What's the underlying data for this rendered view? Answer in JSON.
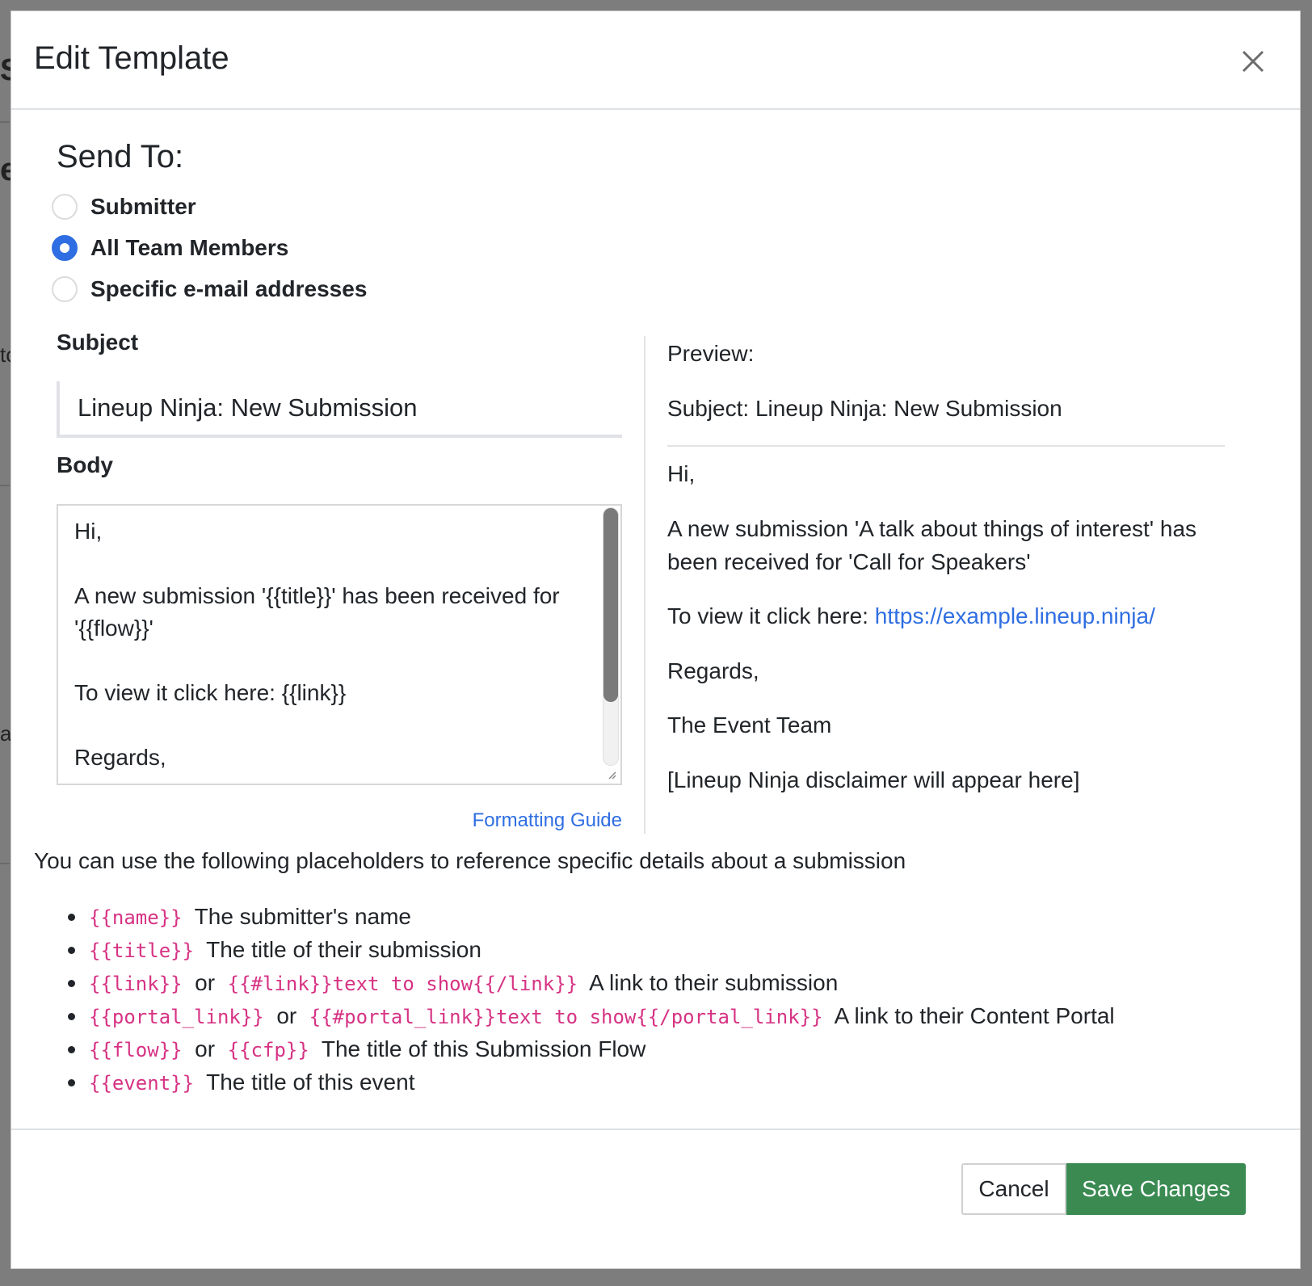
{
  "backdrop": {
    "fragments": [
      "S",
      "e",
      "to",
      "a"
    ]
  },
  "modal": {
    "title": "Edit Template",
    "close_icon": "close-icon"
  },
  "send_to": {
    "title": "Send To:",
    "options": [
      {
        "label": "Submitter",
        "checked": false
      },
      {
        "label": "All Team Members",
        "checked": true
      },
      {
        "label": "Specific e-mail addresses",
        "checked": false
      }
    ]
  },
  "subject": {
    "label": "Subject",
    "value": "Lineup Ninja: New Submission"
  },
  "body": {
    "label": "Body",
    "lines": [
      "Hi,",
      "",
      "A new submission '{{title}}' has been received for '{{flow}}'",
      "",
      "To view it click here: {{link}}",
      "",
      "Regards,"
    ],
    "formatting_link": "Formatting Guide"
  },
  "preview": {
    "label": "Preview:",
    "subject": "Subject: Lineup Ninja: New Submission",
    "greeting": "Hi,",
    "message": "A new submission 'A talk about things of interest' has been received for 'Call for Speakers'",
    "link_prefix": "To view it click here: ",
    "link_text": "https://example.lineup.ninja/",
    "regards": "Regards,",
    "signature": "The Event Team",
    "disclaimer": "[Lineup Ninja disclaimer will appear here]"
  },
  "placeholders": {
    "intro": "You can use the following placeholders to reference specific details about a submission",
    "items": [
      {
        "code1": "{{name}}",
        "or": "",
        "code2": "",
        "desc": "The submitter's name"
      },
      {
        "code1": "{{title}}",
        "or": "",
        "code2": "",
        "desc": "The title of their submission"
      },
      {
        "code1": "{{link}}",
        "or": "or",
        "code2": "{{#link}}text to show{{/link}}",
        "desc": "A link to their submission"
      },
      {
        "code1": "{{portal_link}}",
        "or": "or",
        "code2": "{{#portal_link}}text to show{{/portal_link}}",
        "desc": "A link to their Content Portal"
      },
      {
        "code1": "{{flow}}",
        "or": "or",
        "code2": "{{cfp}}",
        "desc": "The title of this Submission Flow"
      },
      {
        "code1": "{{event}}",
        "or": "",
        "code2": "",
        "desc": "The title of this event"
      }
    ]
  },
  "footer": {
    "cancel_label": "Cancel",
    "save_label": "Save Changes"
  },
  "colors": {
    "accent": "#2f6ee2",
    "save": "#3a8a52",
    "code": "#d63384"
  }
}
